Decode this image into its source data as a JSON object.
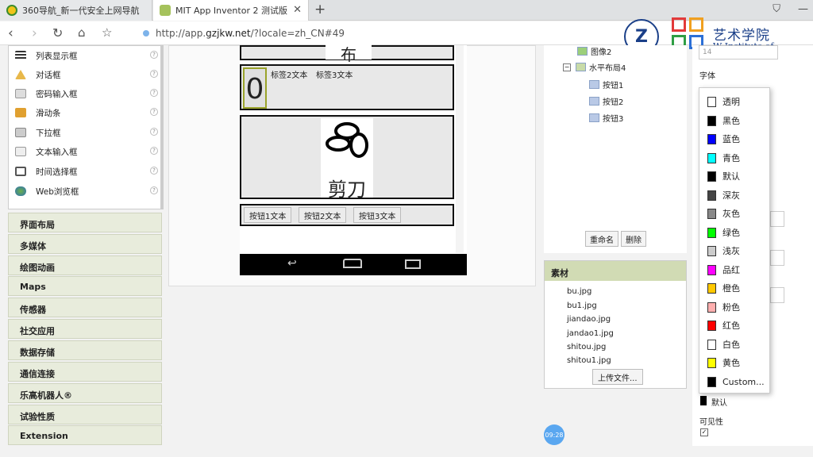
{
  "browser": {
    "tab1_title": "360导航_新一代安全上网导航",
    "tab2_title": "MIT App Inventor 2 测试版",
    "url_prefix": "http://app.",
    "url_domain": "gzjkw.net",
    "url_suffix": "/?locale=zh_CN#49"
  },
  "logo": {
    "cn_text": "艺术学院",
    "en_text": "W Institute of Technology"
  },
  "palette": {
    "items": [
      "列表显示框",
      "对话框",
      "密码输入框",
      "滑动条",
      "下拉框",
      "文本输入框",
      "时间选择框",
      "Web浏览框"
    ],
    "categories": [
      "界面布局",
      "多媒体",
      "绘图动画",
      "Maps",
      "传感器",
      "社交应用",
      "数据存储",
      "通信连接",
      "乐高机器人®",
      "试验性质",
      "Extension"
    ]
  },
  "viewer": {
    "top_label": "布",
    "score": "0",
    "label2": "标签2文本",
    "label3": "标签3文本",
    "scissors_text": "剪刀",
    "buttons": [
      "按钮1文本",
      "按钮2文本",
      "按钮3文本"
    ]
  },
  "tree": {
    "image2": "图像2",
    "hlayout": "水平布局4",
    "btns": [
      "按钮1",
      "按钮2",
      "按钮3"
    ],
    "rename": "重命名",
    "delete": "删除"
  },
  "media": {
    "header": "素材",
    "files": [
      "bu.jpg",
      "bu1.jpg",
      "jiandao.jpg",
      "jandao1.jpg",
      "shitou.jpg",
      "shitou1.jpg"
    ],
    "upload": "上传文件..."
  },
  "props": {
    "font_label": "字体",
    "font_size": "14",
    "default_label": "默认",
    "visible_label": "可见性"
  },
  "colors": [
    {
      "name": "透明",
      "hex": "#ffffff"
    },
    {
      "name": "黑色",
      "hex": "#000000"
    },
    {
      "name": "蓝色",
      "hex": "#0000ff"
    },
    {
      "name": "青色",
      "hex": "#00ffff"
    },
    {
      "name": "默认",
      "hex": "#000000"
    },
    {
      "name": "深灰",
      "hex": "#444444"
    },
    {
      "name": "灰色",
      "hex": "#888888"
    },
    {
      "name": "绿色",
      "hex": "#00ff00"
    },
    {
      "name": "浅灰",
      "hex": "#cccccc"
    },
    {
      "name": "品红",
      "hex": "#ff00ff"
    },
    {
      "name": "橙色",
      "hex": "#ffc800"
    },
    {
      "name": "粉色",
      "hex": "#ffafaf"
    },
    {
      "name": "红色",
      "hex": "#ff0000"
    },
    {
      "name": "白色",
      "hex": "#ffffff"
    },
    {
      "name": "黄色",
      "hex": "#ffff00"
    },
    {
      "name": "Custom...",
      "hex": "#000000"
    }
  ],
  "timer": "09:28"
}
